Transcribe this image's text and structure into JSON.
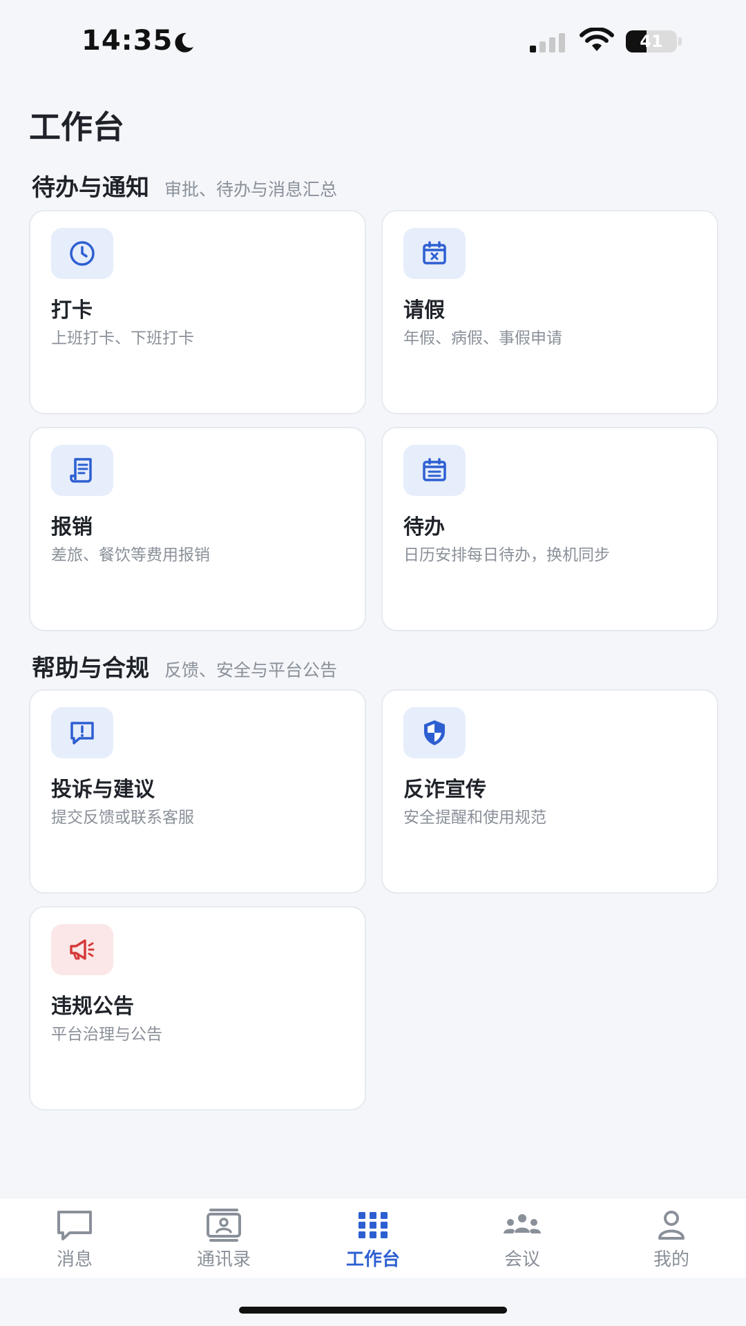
{
  "status_bar": {
    "time": "14:35",
    "battery": "41"
  },
  "page": {
    "title": "工作台"
  },
  "sections": [
    {
      "title": "待办与通知",
      "subtitle": "审批、待办与消息汇总",
      "cards": [
        {
          "title": "打卡",
          "desc": "上班打卡、下班打卡",
          "icon": "clock-icon"
        },
        {
          "title": "请假",
          "desc": "年假、病假、事假申请",
          "icon": "calendar-x-icon"
        },
        {
          "title": "报销",
          "desc": "差旅、餐饮等费用报销",
          "icon": "receipt-icon"
        },
        {
          "title": "待办",
          "desc": "日历安排每日待办，换机同步",
          "icon": "calendar-list-icon"
        }
      ]
    },
    {
      "title": "帮助与合规",
      "subtitle": "反馈、安全与平台公告",
      "cards": [
        {
          "title": "投诉与建议",
          "desc": "提交反馈或联系客服",
          "icon": "chat-alert-icon"
        },
        {
          "title": "反诈宣传",
          "desc": "安全提醒和使用规范",
          "icon": "shield-icon"
        },
        {
          "title": "违规公告",
          "desc": "平台治理与公告",
          "icon": "megaphone-icon"
        }
      ]
    }
  ],
  "bottom_nav": {
    "items": [
      {
        "label": "消息",
        "icon": "message-icon"
      },
      {
        "label": "通讯录",
        "icon": "contacts-icon"
      },
      {
        "label": "工作台",
        "icon": "grid-icon",
        "active": true
      },
      {
        "label": "会议",
        "icon": "group-icon"
      },
      {
        "label": "我的",
        "icon": "person-icon"
      }
    ]
  },
  "colors": {
    "accent": "#2d5fd1",
    "icon_bg": "#e6edfb",
    "danger": "#d63a3a",
    "danger_bg": "#fbe7e7"
  }
}
